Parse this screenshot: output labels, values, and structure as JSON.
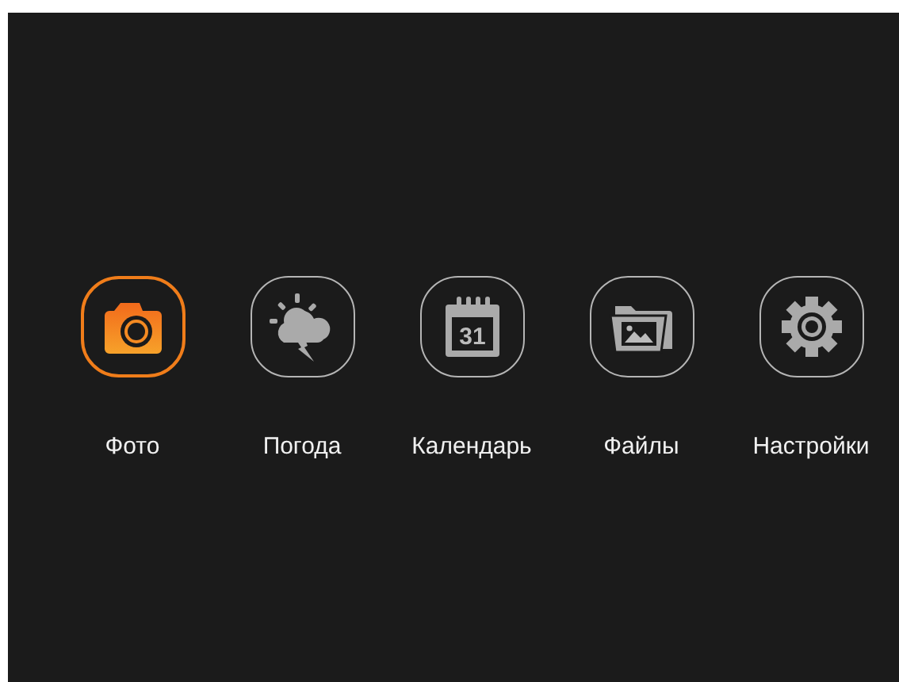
{
  "menu": [
    {
      "kind": "camera",
      "label": "Фото",
      "selected": true
    },
    {
      "kind": "weather",
      "label": "Погода",
      "selected": false
    },
    {
      "kind": "calendar",
      "label": "Календарь",
      "selected": false,
      "icon_text": "31"
    },
    {
      "kind": "folder",
      "label": "Файлы",
      "selected": false
    },
    {
      "kind": "gear",
      "label": "Настройки",
      "selected": false
    }
  ]
}
